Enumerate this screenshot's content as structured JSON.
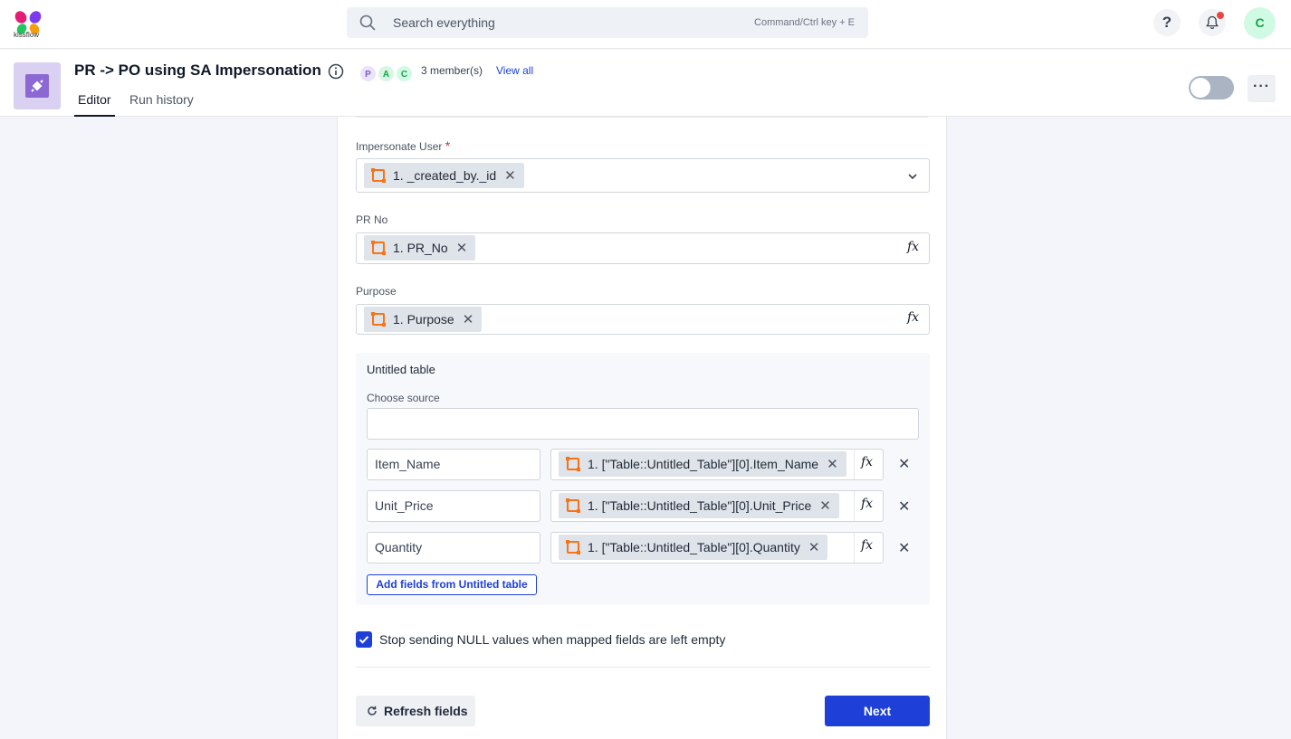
{
  "topbar": {
    "logo_text": "kissflow",
    "search_placeholder": "Search everything",
    "search_shortcut": "Command/Ctrl key + E",
    "help_label": "?",
    "user_initial": "C"
  },
  "header": {
    "title": "PR -> PO using SA Impersonation",
    "members": [
      {
        "initial": "P",
        "bg": "#e9e3fb",
        "fg": "#7c5cc4"
      },
      {
        "initial": "A",
        "bg": "#d9f5e3",
        "fg": "#16a34a"
      },
      {
        "initial": "C",
        "bg": "#d1fae5",
        "fg": "#16a34a"
      }
    ],
    "member_count": "3 member(s)",
    "view_all": "View all",
    "tabs": [
      "Editor",
      "Run history"
    ],
    "more_label": "···"
  },
  "form": {
    "impersonate": {
      "label": "Impersonate User",
      "required": "*",
      "chip": "1. _created_by._id"
    },
    "pr_no": {
      "label": "PR No",
      "chip": "1. PR_No"
    },
    "purpose": {
      "label": "Purpose",
      "chip": "1. Purpose"
    },
    "fx_label": "𝑓𝑥",
    "table": {
      "title": "Untitled table",
      "source_label": "Choose source",
      "rows": [
        {
          "name": "Item_Name",
          "value": "1. [\"Table::Untitled_Table\"][0].Item_Name"
        },
        {
          "name": "Unit_Price",
          "value": "1. [\"Table::Untitled_Table\"][0].Unit_Price"
        },
        {
          "name": "Quantity",
          "value": "1. [\"Table::Untitled_Table\"][0].Quantity"
        }
      ],
      "add_fields": "Add fields from Untitled table"
    },
    "null_checkbox": {
      "checked": true,
      "label": "Stop sending NULL values when mapped fields are left empty"
    },
    "refresh_label": "Refresh fields",
    "next_label": "Next"
  },
  "colors": {
    "accent": "#1e40d8",
    "chip_bg": "#dfe3ea",
    "source_icon": "#f97316"
  }
}
